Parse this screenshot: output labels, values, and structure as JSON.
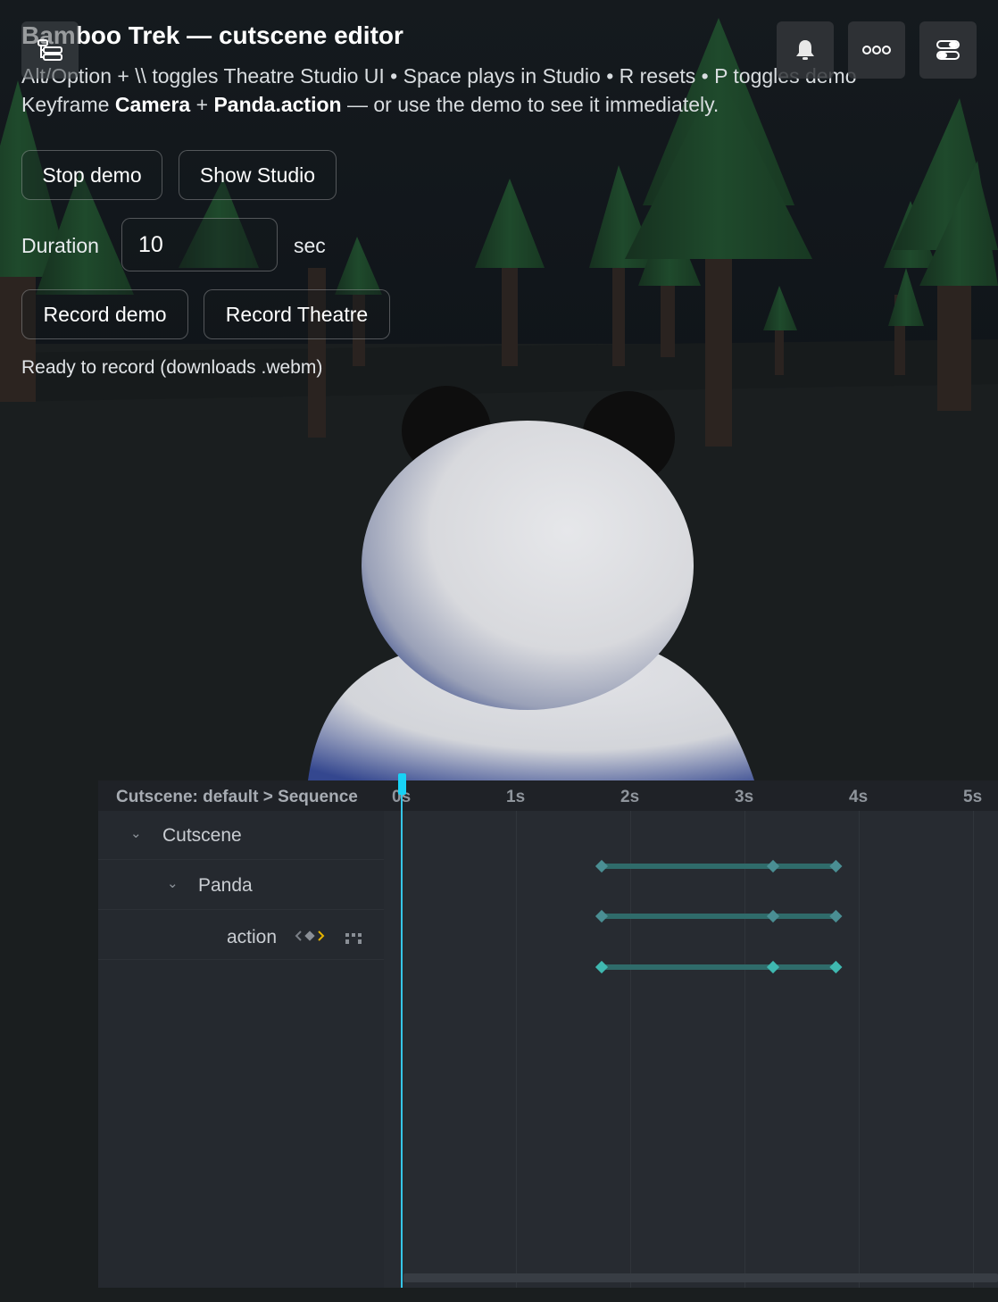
{
  "app": {
    "title": "Bamboo Trek — cutscene editor",
    "hint_line1_prefix": "Alt/Option + \\\\ toggles Theatre Studio UI • Space plays in Studio • R resets • P toggles demo",
    "hint_line2_a": "Keyframe ",
    "hint_line2_b": "Camera",
    "hint_line2_c": " + ",
    "hint_line2_d": "Panda.action",
    "hint_line2_e": " — or use the demo to see it immediately."
  },
  "controls": {
    "stop_demo": "Stop demo",
    "show_studio": "Show Studio",
    "duration_label": "Duration",
    "duration_value": "10",
    "duration_unit": "sec",
    "record_demo": "Record demo",
    "record_theatre": "Record Theatre",
    "status": "Ready to record (downloads .webm)"
  },
  "toolbar": {
    "icons": [
      "outline-panel-icon",
      "bell-icon",
      "more-icon",
      "properties-panel-icon"
    ]
  },
  "sequence": {
    "breadcrumb": "Cutscene: default > Sequence",
    "ticks": [
      "0s",
      "1s",
      "2s",
      "3s",
      "4s",
      "5s"
    ],
    "playhead_time": 0,
    "tree": [
      {
        "label": "Cutscene",
        "expanded": true
      },
      {
        "label": "Panda",
        "expanded": true
      },
      {
        "label": "action"
      }
    ],
    "keyframes": [
      1.75,
      3.25,
      3.8
    ],
    "colors": {
      "playhead": "#18d2f5",
      "keyframe": "#3fb8b0",
      "track": "#2f6b6a"
    }
  }
}
